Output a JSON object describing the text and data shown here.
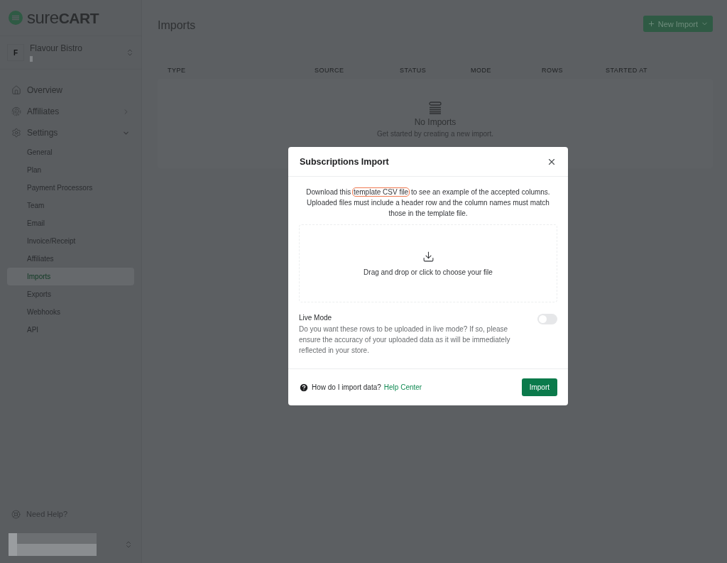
{
  "brand": {
    "logo_text_light": "sure",
    "logo_text_bold": "CART"
  },
  "store": {
    "initial": "F",
    "name": "Flavour Bistro"
  },
  "nav": [
    {
      "label": "Overview",
      "kind": "link"
    },
    {
      "label": "Affiliates",
      "kind": "group",
      "expanded": false
    },
    {
      "label": "Settings",
      "kind": "group",
      "expanded": true
    }
  ],
  "settings_items": [
    {
      "label": "General",
      "selected": false
    },
    {
      "label": "Plan",
      "selected": false
    },
    {
      "label": "Payment Processors",
      "selected": false
    },
    {
      "label": "Team",
      "selected": false
    },
    {
      "label": "Email",
      "selected": false
    },
    {
      "label": "Invoice/Receipt",
      "selected": false
    },
    {
      "label": "Affiliates",
      "selected": false
    },
    {
      "label": "Imports",
      "selected": true
    },
    {
      "label": "Exports",
      "selected": false
    },
    {
      "label": "Webhooks",
      "selected": false
    },
    {
      "label": "API",
      "selected": false
    }
  ],
  "help": {
    "label": "Need Help?"
  },
  "page": {
    "title": "Imports",
    "new_button": "New Import"
  },
  "table": {
    "columns": [
      "TYPE",
      "SOURCE",
      "STATUS",
      "MODE",
      "ROWS",
      "STARTED AT"
    ],
    "empty_title": "No Imports",
    "empty_text": "Get started by creating a new import."
  },
  "modal": {
    "title": "Subscriptions Import",
    "intro_before": "Download this",
    "template_link": {
      "label": "template CSV file",
      "highlighted": true
    },
    "intro_after": "to see an example of the accepted columns. Uploaded files must include a header row and the column names must match those in the template file.",
    "dropzone": "Drag and drop or click to choose your file",
    "live_mode": {
      "label": "Live Mode",
      "description": "Do you want these rows to be uploaded in live mode? If so, please ensure the accuracy of your uploaded data as it will be immediately reflected in your store.",
      "on": false
    },
    "help_question": "How do I import data?",
    "help_link": "Help Center",
    "import_button": "Import"
  }
}
